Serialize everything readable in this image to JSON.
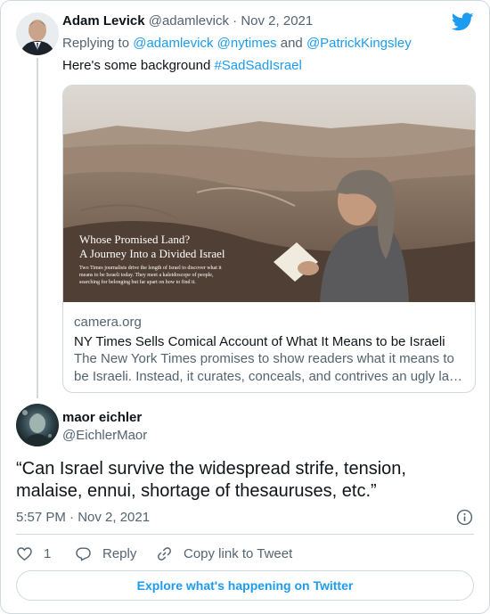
{
  "parent_tweet": {
    "author_name": "Adam Levick",
    "author_handle": "@adamlevick",
    "separator": "·",
    "date": "Nov 2, 2021",
    "replying_prefix": "Replying to ",
    "replying_handles": "@adamlevick @nytimes",
    "replying_and": " and ",
    "replying_last": "@PatrickKingsley",
    "text": "Here's some background ",
    "hashtag": "#SadSadIsrael",
    "card": {
      "image_headline_1": "Whose Promised Land?",
      "image_headline_2": "A Journey Into a Divided Israel",
      "image_caption_1": "Two Times journalists drive the length of Israel to discover what it",
      "image_caption_2": "means to be Israeli today. They meet a kaleidoscope of people,",
      "image_caption_3": "searching for belonging but far apart on how to find it.",
      "domain": "camera.org",
      "title": "NY Times Sells Comical Account of What It Means to be Israeli",
      "description": "The New York Times promises to show readers what it means to be Israeli. Instead, it curates, conceals, and contrives an ugly la…"
    }
  },
  "main_tweet": {
    "author_name": "maor eichler",
    "author_handle": "@EichlerMaor",
    "text": "“Can Israel survive the widespread strife, tension, malaise, ennui, shortage of thesauruses, etc.”",
    "timestamp": "5:57 PM · Nov 2, 2021"
  },
  "actions": {
    "like_count": "1",
    "reply_label": "Reply",
    "copy_label": "Copy link to Tweet"
  },
  "explore_label": "Explore what's happening on Twitter",
  "icons": {
    "brand": "twitter-bird-icon",
    "info": "info-icon",
    "like": "heart-icon",
    "reply": "reply-bubble-icon",
    "copy": "link-icon"
  },
  "colors": {
    "accent": "#1d9bf0",
    "text_primary": "#0f1419",
    "text_secondary": "#536471",
    "border": "#cfd9de"
  }
}
